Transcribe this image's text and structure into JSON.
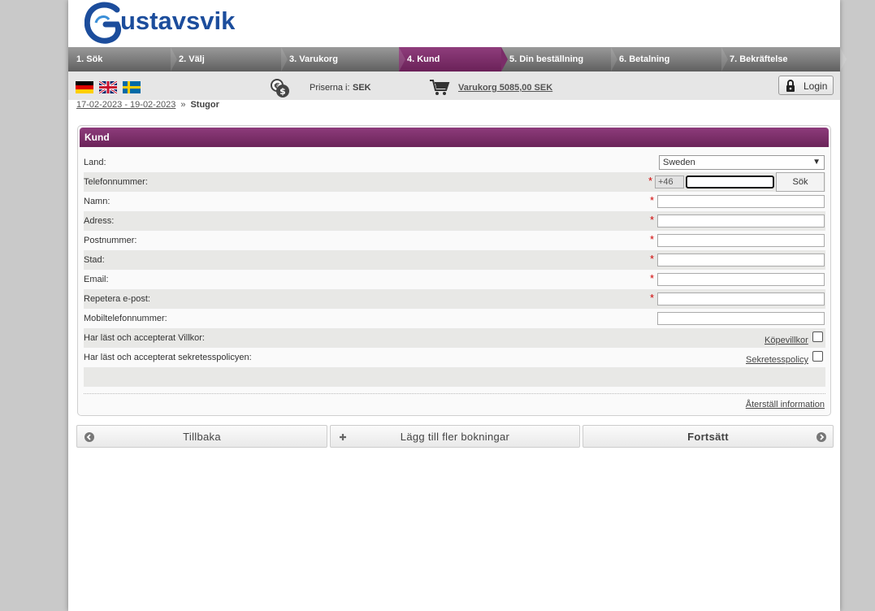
{
  "logo": {
    "text": "ustavsvik"
  },
  "steps": [
    {
      "label": "1. Sök",
      "active": false
    },
    {
      "label": "2. Välj",
      "active": false
    },
    {
      "label": "3. Varukorg",
      "active": false
    },
    {
      "label": "4. Kund",
      "active": true
    },
    {
      "label": "5. Din beställning",
      "active": false
    },
    {
      "label": "6. Betalning",
      "active": false
    },
    {
      "label": "7. Bekräftelse",
      "active": false
    }
  ],
  "toolbar": {
    "flags": [
      "german-flag-icon",
      "uk-flag-icon",
      "swedish-flag-icon"
    ],
    "price_label": "Priserna i:",
    "price_currency": "SEK",
    "cart_link": "Varukorg 5085,00 SEK",
    "login_label": "Login"
  },
  "breadcrumb": {
    "date_range": "17-02-2023 - 19-02-2023",
    "separator": "»",
    "current": "Stugor"
  },
  "form": {
    "title": "Kund",
    "country_label": "Land:",
    "country_value": "Sweden",
    "phone_label": "Telefonnummer:",
    "phone_prefix": "+46",
    "phone_value": "",
    "search_label": "Sök",
    "name_label": "Namn:",
    "address_label": "Adress:",
    "postcode_label": "Postnummer:",
    "city_label": "Stad:",
    "email_label": "Email:",
    "email_repeat_label": "Repetera e-post:",
    "mobile_label": "Mobiltelefonnummer:",
    "terms_label": "Har läst och accepterat Villkor:",
    "terms_link": "Köpevillkor",
    "privacy_label": "Har läst och accepterat sekretesspolicyen:",
    "privacy_link": "Sekretesspolicy",
    "reset_link": "Återställ information",
    "required_mark": "*"
  },
  "buttons": {
    "back": "Tillbaka",
    "add_more": "Lägg till fler bokningar",
    "continue": "Fortsätt"
  },
  "colors": {
    "accent": "#7a2c68",
    "brand": "#1c4d9c",
    "required": "#d00000"
  }
}
